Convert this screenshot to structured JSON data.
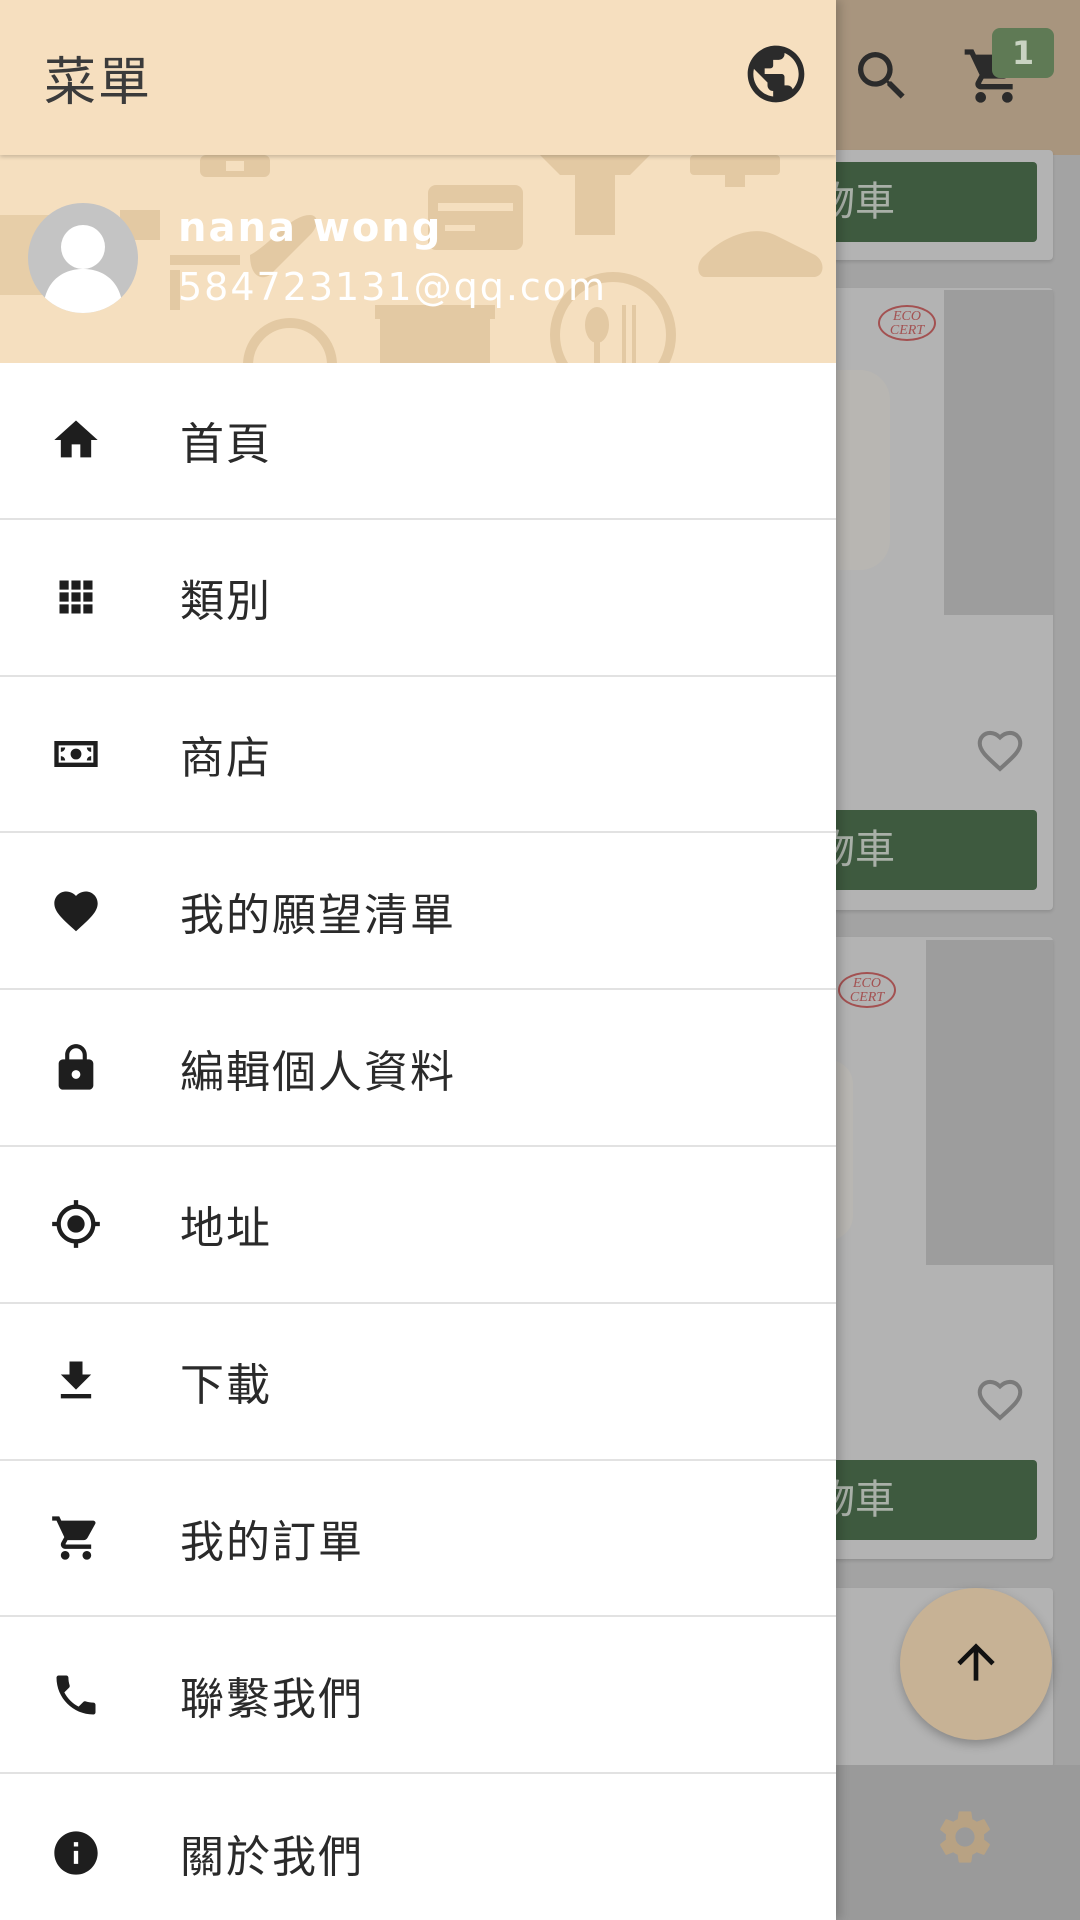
{
  "drawer": {
    "title": "菜單",
    "user": {
      "name": "nana wong",
      "email": "584723131@qq.com"
    },
    "menu": [
      {
        "label": "首頁",
        "icon": "home-icon"
      },
      {
        "label": "類別",
        "icon": "grid-icon"
      },
      {
        "label": "商店",
        "icon": "money-icon"
      },
      {
        "label": "我的願望清單",
        "icon": "heart-icon"
      },
      {
        "label": "編輯個人資料",
        "icon": "lock-icon"
      },
      {
        "label": "地址",
        "icon": "location-target-icon"
      },
      {
        "label": "下載",
        "icon": "download-icon"
      },
      {
        "label": "我的訂單",
        "icon": "cart-icon"
      },
      {
        "label": "聯繫我們",
        "icon": "phone-icon"
      },
      {
        "label": "關於我們",
        "icon": "info-icon"
      }
    ]
  },
  "background": {
    "cart_badge_count": "1",
    "cart_buttons": [
      "物車",
      "物車",
      "物車"
    ],
    "eco_logo_text": "ECO CERT"
  },
  "colors": {
    "drawer_header": "#f6dfbf",
    "add_to_cart_button": "#3e5a3f",
    "fab": "#c7b295"
  }
}
